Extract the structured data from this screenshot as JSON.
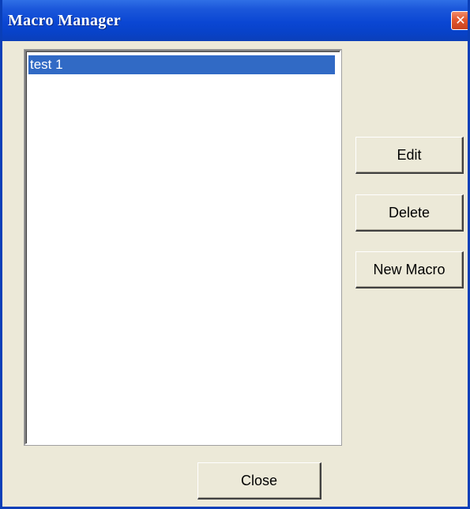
{
  "window": {
    "title": "Macro Manager",
    "close_glyph": "✕"
  },
  "macro_list": {
    "items": [
      {
        "label": "test 1",
        "selected": true
      }
    ]
  },
  "buttons": {
    "edit": "Edit",
    "delete": "Delete",
    "new_macro": "New Macro",
    "close": "Close"
  },
  "colors": {
    "titlebar": "#0a46d3",
    "selection": "#316ac5",
    "dialog_bg": "#ece9d8",
    "close_button": "#e2582f"
  },
  "icons": {
    "title_close": "close-icon"
  }
}
